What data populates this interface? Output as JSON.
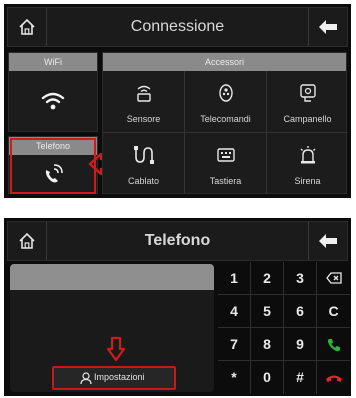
{
  "screen1": {
    "title": "Connessione",
    "wifi": {
      "label": "WiFi",
      "icon": "wifi-icon"
    },
    "telefono": {
      "label": "Telefono",
      "icon": "phone-ring-icon"
    },
    "accessori": {
      "label": "Accessori",
      "items": [
        {
          "label": "Sensore",
          "icon": "sensor-icon"
        },
        {
          "label": "Telecomandi",
          "icon": "remote-icon"
        },
        {
          "label": "Campanello",
          "icon": "doorbell-icon"
        },
        {
          "label": "Cablato",
          "icon": "wired-icon"
        },
        {
          "label": "Tastiera",
          "icon": "keyboard-icon"
        },
        {
          "label": "Sirena",
          "icon": "siren-icon"
        }
      ]
    }
  },
  "screen2": {
    "title": "Telefono",
    "settings_label": "Impostazioni",
    "keys": [
      "1",
      "2",
      "3",
      "⌫",
      "4",
      "5",
      "6",
      "C",
      "7",
      "8",
      "9",
      "call",
      "*",
      "0",
      "#",
      "hangup"
    ]
  },
  "colors": {
    "highlight_red": "#d11a1a",
    "call_green": "#2fb335",
    "hangup_red": "#e0262a"
  }
}
